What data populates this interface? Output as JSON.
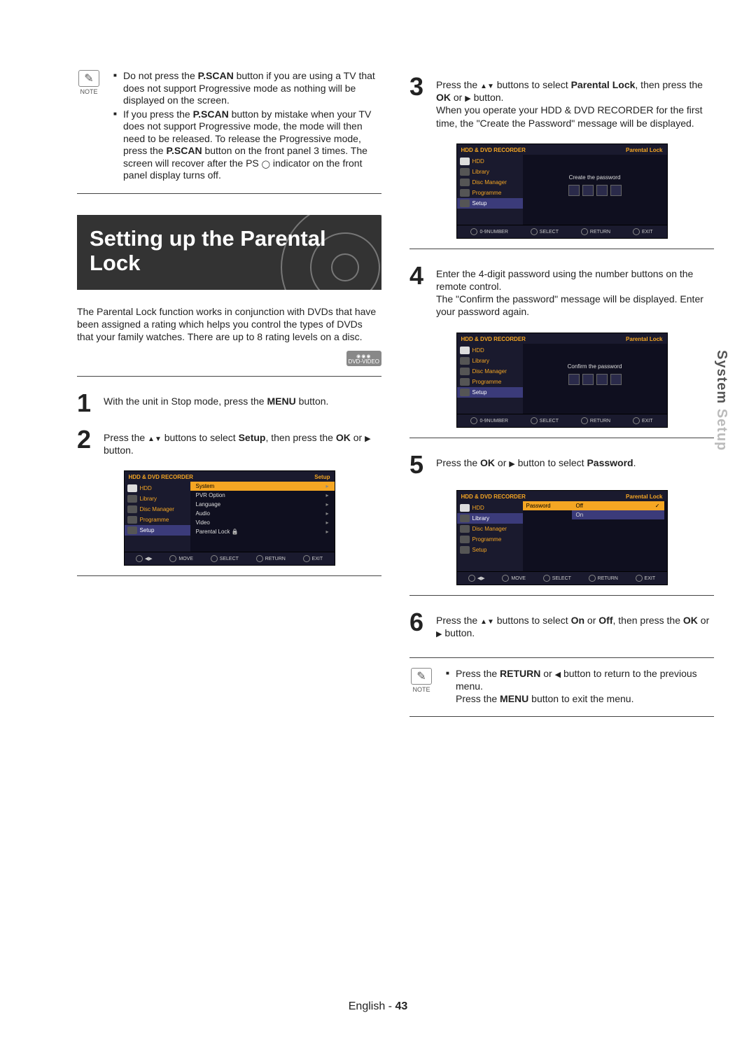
{
  "noteLabel": "NOTE",
  "topNote": {
    "items": [
      "Do not press the <b>P.SCAN</b> button if you are using a TV that does not support Progressive mode as nothing will be displayed on the screen.",
      "If you press the <b>P.SCAN</b> button by mistake when your TV does not support Progressive mode, the mode will then need to be released. To release the Progressive mode, press the <b>P.SCAN</b> button on the front panel 3 times. The screen will recover after the PS <span class='circ'></span> indicator on the front panel display turns off."
    ]
  },
  "heading": "Setting up the Parental Lock",
  "intro": "The Parental Lock function works in conjunction with DVDs that have been assigned a rating which helps you control the types of DVDs that your family watches. There are up to 8 rating levels on a disc.",
  "badge": "DVD-VIDEO",
  "steps": {
    "s1": "With the unit in Stop mode, press the <b>MENU</b> button.",
    "s2": "Press the <span class='tri-up'></span><span class='tri-dn'></span> buttons to select <b>Setup</b>, then press the <b>OK</b> or <span class='tri-rt'></span> button.",
    "s3": "Press the <span class='tri-up'></span><span class='tri-dn'></span> buttons to select <b>Parental Lock</b>, then press the <b>OK</b> or <span class='tri-rt'></span> button.<br>When you operate your HDD & DVD RECORDER for the first time, the \"Create the Password\" message will be displayed.",
    "s4": "Enter the 4-digit password using the number buttons on the remote control.<br>The \"Confirm the password\" message will be displayed. Enter your password again.",
    "s5": "Press the <b>OK</b> or <span class='tri-rt'></span> button to select <b>Password</b>.",
    "s6": "Press the <span class='tri-up'></span><span class='tri-dn'></span> buttons to select <b>On</b> or <b>Off</b>, then press the <b>OK</b> or <span class='tri-rt'></span> button."
  },
  "bottomNote": "Press the <b>RETURN</b> or <span class='tri-lt'></span> button to return to the previous menu.<br>Press the <b>MENU</b> button to exit the menu.",
  "osd": {
    "recorder": "HDD & DVD RECORDER",
    "hdd": "HDD",
    "side": [
      "Library",
      "Disc Manager",
      "Programme",
      "Setup"
    ],
    "setupTitle": "Setup",
    "setupItems": [
      "System",
      "PVR Option",
      "Language",
      "Audio",
      "Video",
      "Parental Lock"
    ],
    "plTitle": "Parental Lock",
    "createMsg": "Create the password",
    "confirmMsg": "Confirm the password",
    "password": "Password",
    "off": "Off",
    "on": "On",
    "foot_move": "MOVE",
    "foot_num": "0-9NUMBER",
    "foot_sel": "SELECT",
    "foot_ret": "RETURN",
    "foot_exit": "EXIT",
    "foot_arrows": "◀▶"
  },
  "sideTab": {
    "a": "System ",
    "b": "Setup"
  },
  "footer": {
    "lang": "English",
    "sep": " - ",
    "page": "43"
  }
}
